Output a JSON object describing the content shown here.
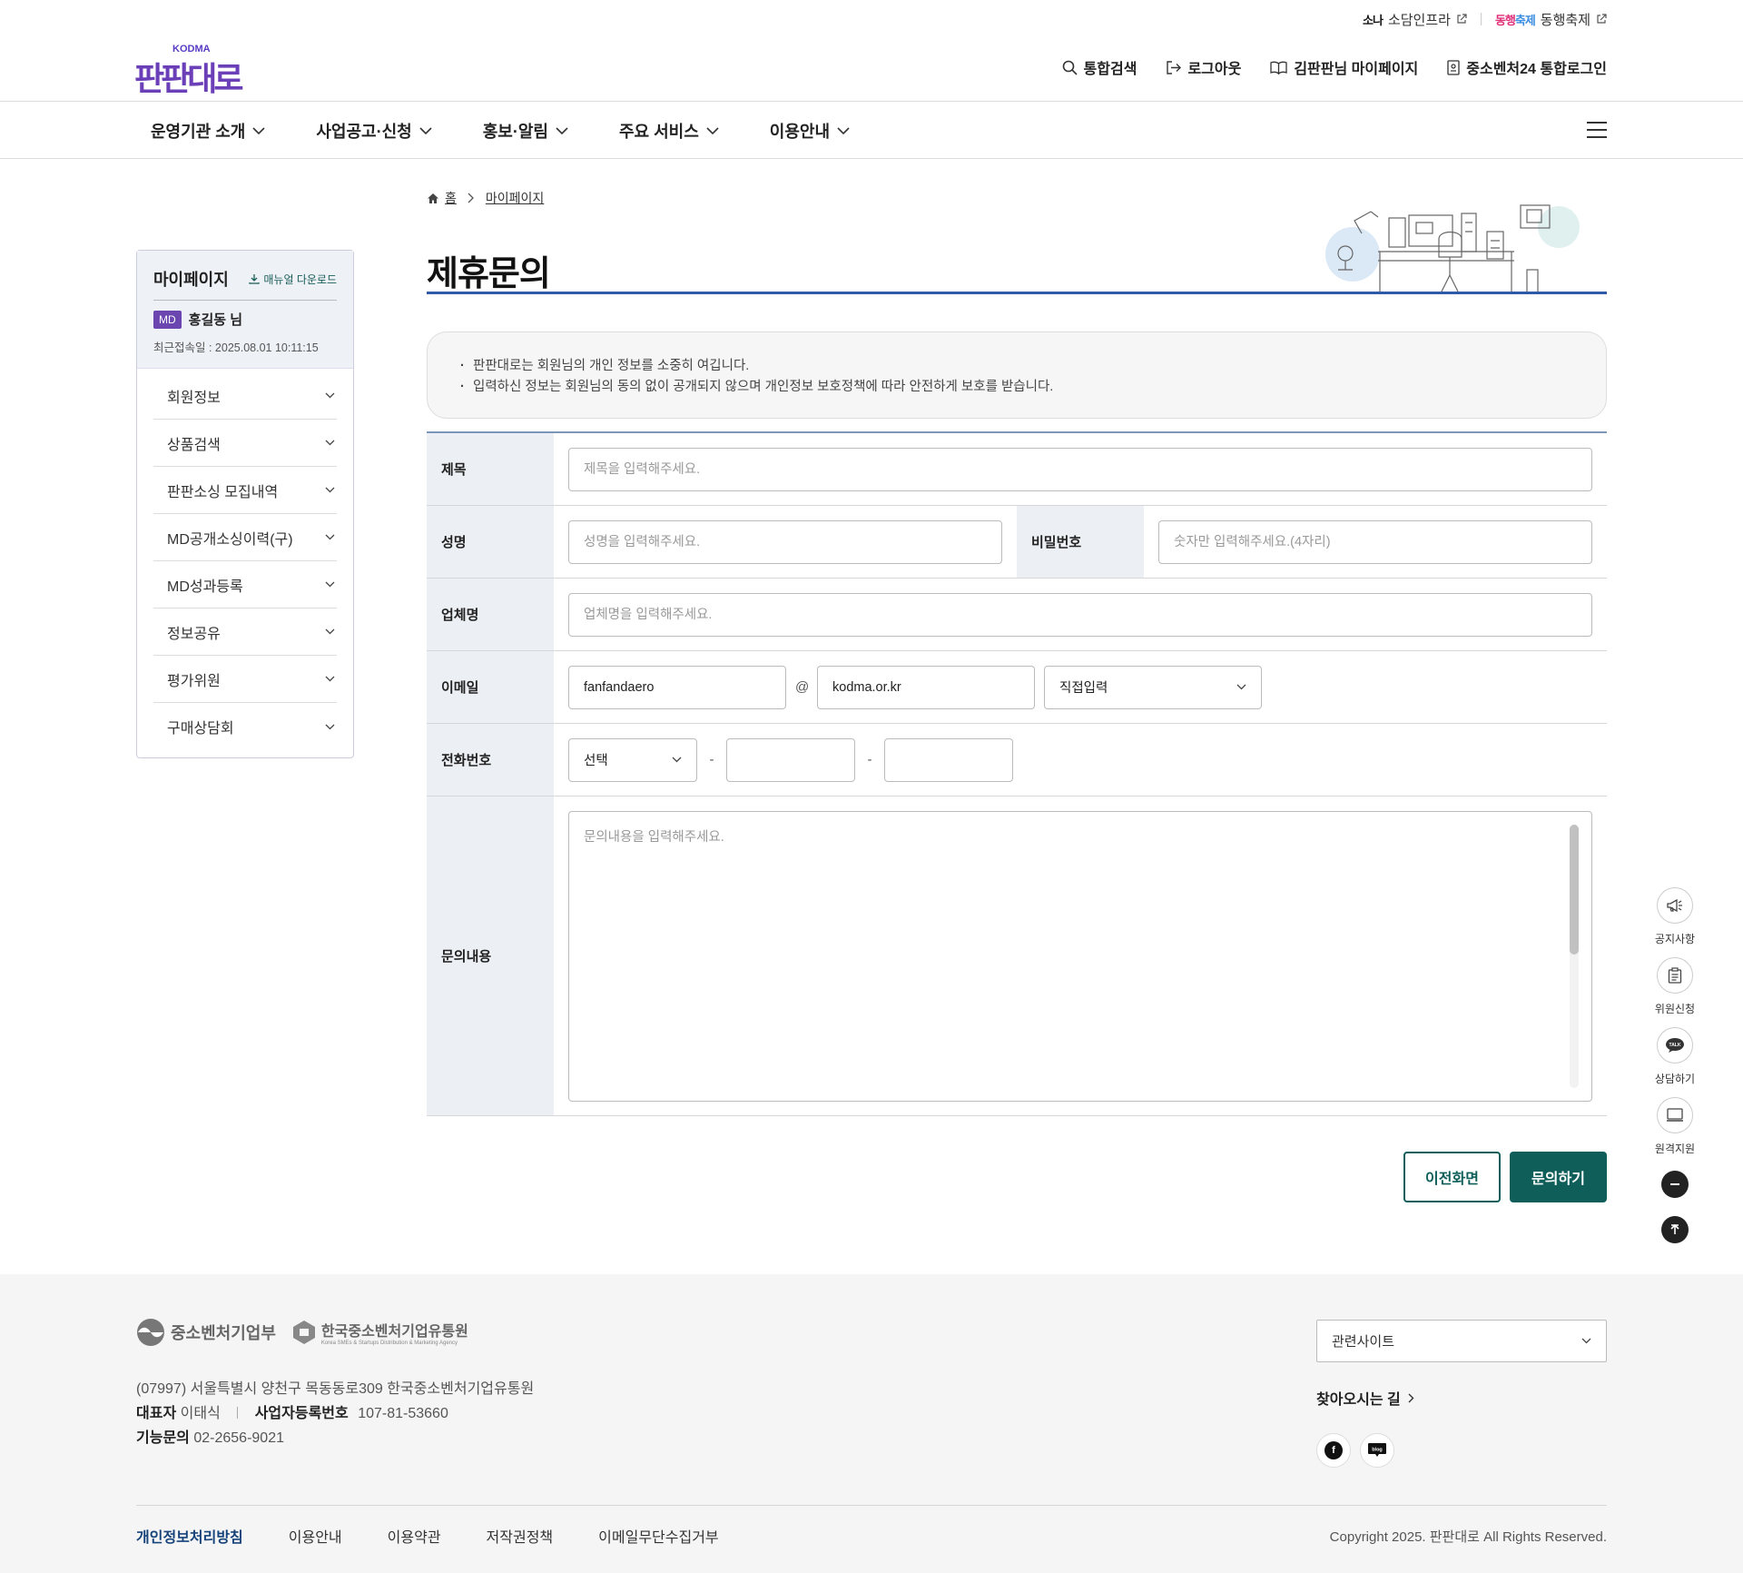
{
  "util": {
    "sodam_logo": "소나",
    "sodam": "소담인프라",
    "festival_logo_a": "동행",
    "festival_logo_b": "축제",
    "festival": "동행축제"
  },
  "header": {
    "logo_top": "KODMA",
    "logo_word": "판판대로",
    "nav": [
      "통합검색",
      "로그아웃",
      "김판판님 마이페이지",
      "중소벤처24 통합로그인"
    ]
  },
  "gnb": {
    "items": [
      "운영기관 소개",
      "사업공고·신청",
      "홍보·알림",
      "주요 서비스",
      "이용안내"
    ]
  },
  "sidebar": {
    "title": "마이페이지",
    "manual": "매뉴얼 다운로드",
    "badge": "MD",
    "user": "홍길동 님",
    "last_login": "최근접속일 : 2025.08.01 10:11:15",
    "items": [
      "회원정보",
      "상품검색",
      "판판소싱 모집내역",
      "MD공개소싱이력(구)",
      "MD성과등록",
      "정보공유",
      "평가위원",
      "구매상담회"
    ]
  },
  "breadcrumb": {
    "home": "홈",
    "current": "마이페이지"
  },
  "page": {
    "title": "제휴문의"
  },
  "notice": [
    "판판대로는 회원님의 개인 정보를 소중히 여깁니다.",
    "입력하신 정보는 회원님의 동의 없이 공개되지 않으며 개인정보 보호정책에 따라 안전하게 보호를 받습니다."
  ],
  "form": {
    "subject": {
      "label": "제목",
      "placeholder": "제목을 입력해주세요."
    },
    "name": {
      "label": "성명",
      "placeholder": "성명을 입력해주세요."
    },
    "password": {
      "label": "비밀번호",
      "placeholder": "숫자만 입력해주세요.(4자리)"
    },
    "company": {
      "label": "업체명",
      "placeholder": "업체명을 입력해주세요."
    },
    "email": {
      "label": "이메일",
      "id": "fanfandaero",
      "at": "@",
      "domain": "kodma.or.kr",
      "select": "직접입력"
    },
    "phone": {
      "label": "전화번호",
      "select": "선택",
      "dash": "-"
    },
    "content": {
      "label": "문의내용",
      "placeholder": "문의내용을 입력해주세요."
    }
  },
  "buttons": {
    "prev": "이전화면",
    "submit": "문의하기"
  },
  "quick": [
    "공지사항",
    "위원신청",
    "상담하기",
    "원격지원"
  ],
  "footer": {
    "ministry": "중소벤처기업부",
    "agency": "한국중소벤처기업유통원",
    "agency_sub": "Korea SMEs & Startups Distribution & Marketing Agency",
    "address": "(07997) 서울특별시 양천구 목동동로309 한국중소벤처기업유통원",
    "ceo_label": "대표자",
    "ceo": "이태식",
    "biz_label": "사업자등록번호",
    "biz": "107-81-53660",
    "tel_label": "기능문의",
    "tel": "02-2656-9021",
    "related": "관련사이트",
    "way": "찾아오시는 길",
    "links": [
      "개인정보처리방침",
      "이용안내",
      "이용약관",
      "저작권정책",
      "이메일무단수집거부"
    ],
    "copyright": "Copyright 2025. 판판대로 All Rights Reserved."
  },
  "colors": {
    "accent": "#0f5e5a",
    "title_line": "#2e5aa8",
    "brand": "#6b3fb8"
  },
  "icons": {
    "nav": [
      "search-icon",
      "logout-icon",
      "book-icon",
      "id-card-icon"
    ],
    "quick": [
      "megaphone-icon",
      "clipboard-icon",
      "chat-icon",
      "monitor-icon"
    ]
  }
}
